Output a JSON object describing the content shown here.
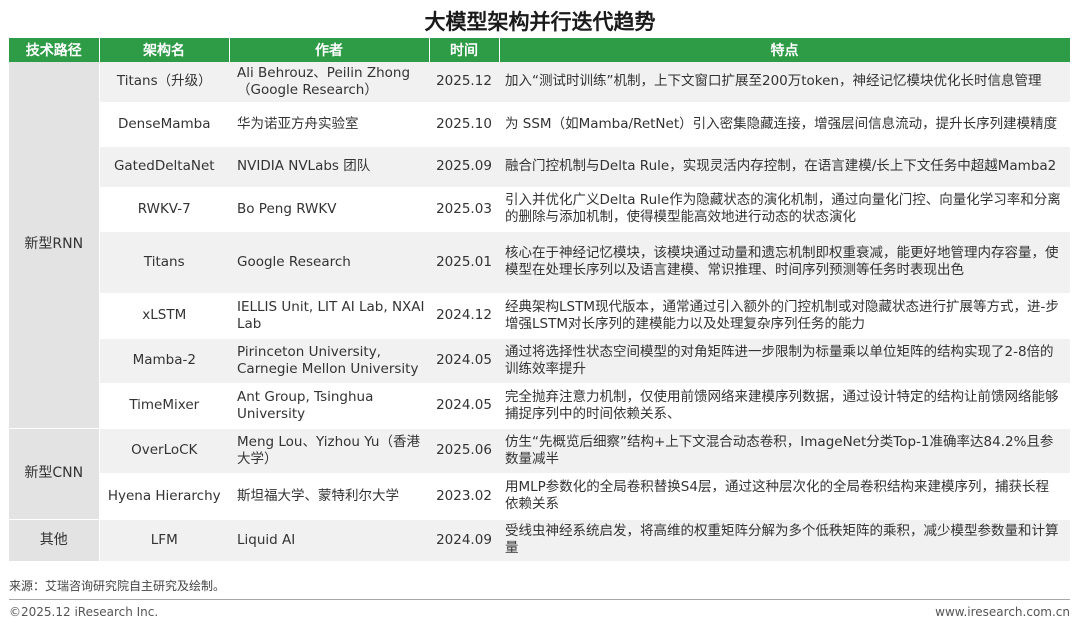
{
  "title": "大模型架构并行迭代趋势",
  "columns": [
    "技术路径",
    "架构名",
    "作者",
    "时间",
    "特点"
  ],
  "groups": [
    {
      "category": "新型RNN",
      "rows": [
        {
          "name": "Titans（升级）",
          "author": "Ali Behrouz、Peilin Zhong（Google Research）",
          "time": "2025.12",
          "feature": "加入“测试时训练”机制，上下文窗口扩展至200万token，神经记忆模块优化长时信息管理"
        },
        {
          "name": "DenseMamba",
          "author": "华为诺亚方舟实验室",
          "time": "2025.10",
          "feature": "为 SSM（如Mamba/RetNet）引入密集隐藏连接，增强层间信息流动，提升长序列建模精度"
        },
        {
          "name": "GatedDeltaNet",
          "author": "NVIDIA NVLabs 团队",
          "time": "2025.09",
          "feature": "融合门控机制与Delta Rule，实现灵活内存控制，在语言建模/长上下文任务中超越Mamba2"
        },
        {
          "name": "RWKV-7",
          "author": "Bo Peng RWKV",
          "time": "2025.03",
          "feature": "引入并优化广义Delta Rule作为隐藏状态的演化机制，通过向量化门控、向量化学习率和分离的删除与添加机制，使得模型能高效地进行动态的状态演化"
        },
        {
          "name": "Titans",
          "author": "Google Research",
          "time": "2025.01",
          "feature": "核心在于神经记忆模块，该模块通过动量和遗忘机制即权重衰减，能更好地管理内存容量，使模型在处理长序列以及语言建模、常识推理、时间序列预测等任务时表现出色"
        },
        {
          "name": "xLSTM",
          "author": "IELLIS Unit, LIT AI Lab, NXAI Lab",
          "time": "2024.12",
          "feature": "经典架构LSTM现代版本，通常通过引入额外的门控机制或对隐藏状态进行扩展等方式，进-步增强LSTM对长序列的建模能力以及处理复杂序列任务的能力"
        },
        {
          "name": "Mamba-2",
          "author": "Pirinceton University, Carnegie Mellon University",
          "time": "2024.05",
          "feature": "通过将选择性状态空间模型的对角矩阵进一步限制为标量乘以单位矩阵的结构实现了2-8倍的训练效率提升"
        },
        {
          "name": "TimeMixer",
          "author": "Ant Group, Tsinghua University",
          "time": "2024.05",
          "feature": "完全抛弃注意力机制，仅使用前馈网络来建模序列数据，通过设计特定的结构让前馈网络能够捕捉序列中的时间依赖关系、"
        }
      ]
    },
    {
      "category": "新型CNN",
      "rows": [
        {
          "name": "OverLoCK",
          "author": "Meng Lou、Yizhou Yu（香港大学）",
          "time": "2025.06",
          "feature": "仿生“先概览后细察”结构+上下文混合动态卷积，ImageNet分类Top-1准确率达84.2%且参数量减半"
        },
        {
          "name": "Hyena Hierarchy",
          "author": "斯坦福大学、蒙特利尔大学",
          "time": "2023.02",
          "feature": "用MLP参数化的全局卷积替换S4层，通过这种层次化的全局卷积结构来建模序列，捕获长程依赖关系"
        }
      ]
    },
    {
      "category": "其他",
      "rows": [
        {
          "name": "LFM",
          "author": "Liquid AI",
          "time": "2024.09",
          "feature": "受线虫神经系统启发，将高维的权重矩阵分解为多个低秩矩阵的乘积，减少模型参数量和计算量"
        }
      ]
    }
  ],
  "source": "来源：艾瑞咨询研究院自主研究及绘制。",
  "copyright": "©2025.12 iResearch Inc.",
  "website": "www.iresearch.com.cn",
  "colors": {
    "header_green": "#2e9b46",
    "category_gray": "#e3e3e3",
    "row_stripe": "#f1f1f1"
  }
}
